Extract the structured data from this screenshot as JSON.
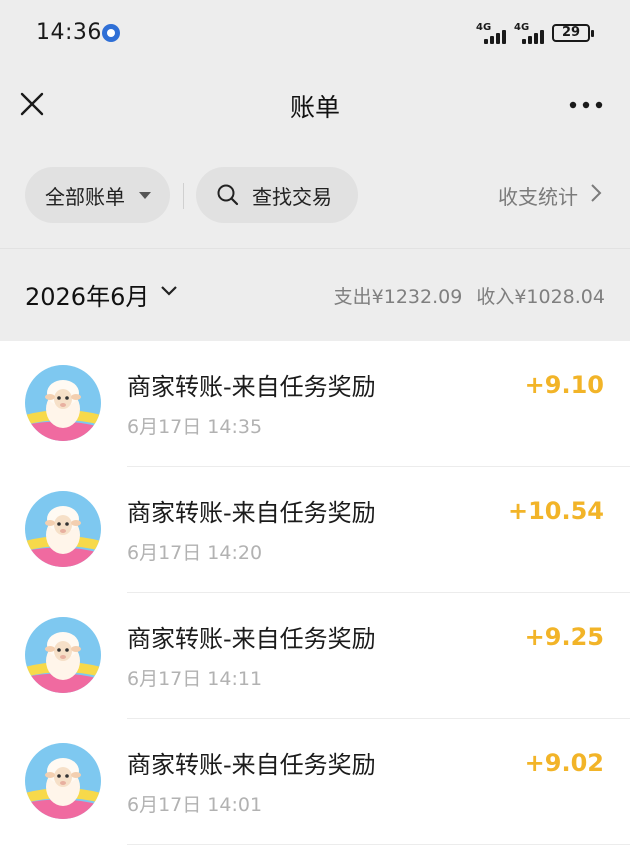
{
  "status_bar": {
    "time": "14:36",
    "signal_1_label": "4G",
    "signal_2_label": "4G",
    "battery": "29"
  },
  "nav": {
    "title": "账单"
  },
  "filters": {
    "all_bills": "全部账单",
    "search": "查找交易",
    "stats": "收支统计"
  },
  "period": {
    "month": "2026年6月",
    "expense": "支出¥1232.09",
    "income": "收入¥1028.04"
  },
  "transactions": [
    {
      "title": "商家转账-来自任务奖励",
      "time": "6月17日 14:35",
      "amount": "+9.10"
    },
    {
      "title": "商家转账-来自任务奖励",
      "time": "6月17日 14:20",
      "amount": "+10.54"
    },
    {
      "title": "商家转账-来自任务奖励",
      "time": "6月17日 14:11",
      "amount": "+9.25"
    },
    {
      "title": "商家转账-来自任务奖励",
      "time": "6月17日 14:01",
      "amount": "+9.02"
    }
  ],
  "colors": {
    "income_amount": "#f2b428",
    "background": "#ededed",
    "list_background": "#ffffff"
  },
  "icons": {
    "close": "close-icon",
    "more": "more-icon",
    "search": "search-icon",
    "dropdown": "caret-down-icon",
    "chevron_right": "chevron-right-icon",
    "chevron_down": "chevron-down-icon",
    "avatar": "sheep-avatar"
  }
}
